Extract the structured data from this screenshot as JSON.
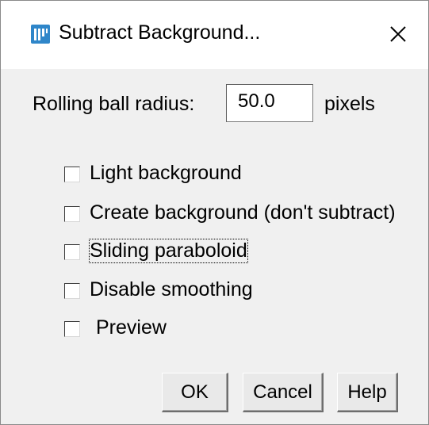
{
  "window": {
    "title": "Subtract Background...",
    "app_icon": "imagej-icon",
    "close_icon": "close-icon"
  },
  "radius": {
    "label": "Rolling ball radius:",
    "value": "50.0",
    "unit": "pixels"
  },
  "options": [
    {
      "label": "Light background",
      "checked": false
    },
    {
      "label": "Create background (don't subtract)",
      "checked": false
    },
    {
      "label": "Sliding paraboloid",
      "checked": false,
      "focused": true
    },
    {
      "label": "Disable smoothing",
      "checked": false
    },
    {
      "label": "Preview",
      "checked": false
    }
  ],
  "buttons": {
    "ok": "OK",
    "cancel": "Cancel",
    "help": "Help"
  }
}
